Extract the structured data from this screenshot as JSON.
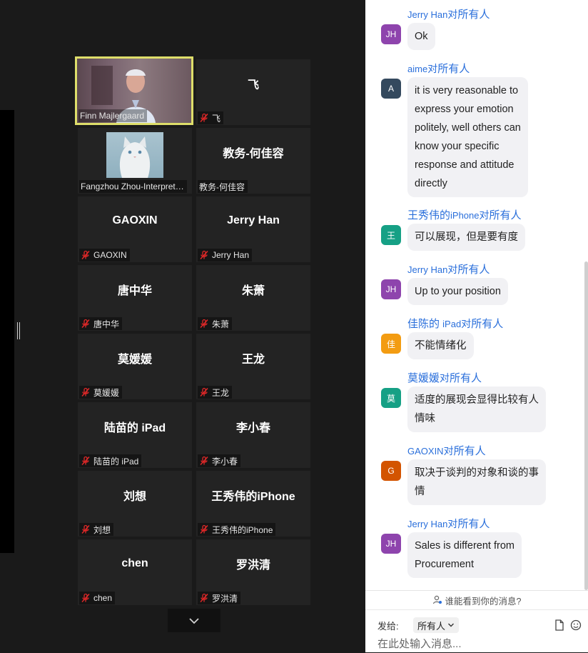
{
  "participants": [
    {
      "display": "",
      "tag": "Finn Majlergaard",
      "muted": false,
      "type": "video-man"
    },
    {
      "display": "飞",
      "tag": "飞",
      "muted": true
    },
    {
      "display": "",
      "tag": "Fangzhou Zhou-Interpret…",
      "muted": false,
      "type": "cat"
    },
    {
      "display": "教务-何佳容",
      "tag": "教务-何佳容",
      "muted": false
    },
    {
      "display": "GAOXIN",
      "tag": "GAOXIN",
      "muted": true
    },
    {
      "display": "Jerry Han",
      "tag": "Jerry Han",
      "muted": true
    },
    {
      "display": "唐中华",
      "tag": "唐中华",
      "muted": true
    },
    {
      "display": "朱萧",
      "tag": "朱萧",
      "muted": true
    },
    {
      "display": "莫媛媛",
      "tag": "莫媛媛",
      "muted": true
    },
    {
      "display": "王龙",
      "tag": "王龙",
      "muted": true
    },
    {
      "display": "陆苗的 iPad",
      "tag": "陆苗的 iPad",
      "muted": true
    },
    {
      "display": "李小春",
      "tag": "李小春",
      "muted": true
    },
    {
      "display": "刘想",
      "tag": "刘想",
      "muted": true
    },
    {
      "display": "王秀伟的iPhone",
      "tag": "王秀伟的iPhone",
      "muted": true
    },
    {
      "display": "chen",
      "tag": "chen",
      "muted": true
    },
    {
      "display": "罗洪清",
      "tag": "罗洪清",
      "muted": true
    }
  ],
  "chat": {
    "messages": [
      {
        "avatar": "JH",
        "avatar_color": "#8e44ad",
        "sender": "Jerry Han",
        "to": "对",
        "recipient": "所有人",
        "lines": [
          "Ok"
        ]
      },
      {
        "avatar": "A",
        "avatar_color": "#34495e",
        "sender": "aime",
        "to": "对",
        "recipient": "所有人",
        "lines": [
          "it is very reasonable to",
          "express your emotion",
          "politely, well others can",
          "know your specific",
          "response and attitude",
          "directly"
        ]
      },
      {
        "avatar": "王",
        "avatar_color": "#16a085",
        "sender": "王秀伟的",
        "sender_suffix": "iPhone",
        "to": "对",
        "recipient": "所有人",
        "lines": [
          "可以展现，但是要有度"
        ]
      },
      {
        "avatar": "JH",
        "avatar_color": "#8e44ad",
        "sender": "Jerry Han",
        "to": "对",
        "recipient": "所有人",
        "lines": [
          "Up to your position"
        ]
      },
      {
        "avatar": "佳",
        "avatar_color": "#f39c12",
        "sender": "佳陈的 ",
        "sender_suffix": "iPad",
        "to": "对",
        "recipient": "所有人",
        "lines": [
          "不能情绪化"
        ]
      },
      {
        "avatar": "莫",
        "avatar_color": "#16a085",
        "sender": "莫媛媛",
        "to": "对",
        "recipient": "所有人",
        "lines": [
          "适度的展现会显得比较有人",
          "情味"
        ]
      },
      {
        "avatar": "G",
        "avatar_color": "#d35400",
        "sender": "GAOXIN",
        "to": "对",
        "recipient": "所有人",
        "lines": [
          "取决于谈判的对象和谈的事",
          "情"
        ]
      },
      {
        "avatar": "JH",
        "avatar_color": "#8e44ad",
        "sender": "Jerry Han",
        "to": "对",
        "recipient": "所有人",
        "lines": [
          "Sales is different from",
          "Procurement"
        ]
      }
    ],
    "visibility_note": "谁能看到你的消息?",
    "send_to_label": "发给:",
    "recipient": "所有人",
    "input_placeholder": "在此处输入消息..."
  }
}
